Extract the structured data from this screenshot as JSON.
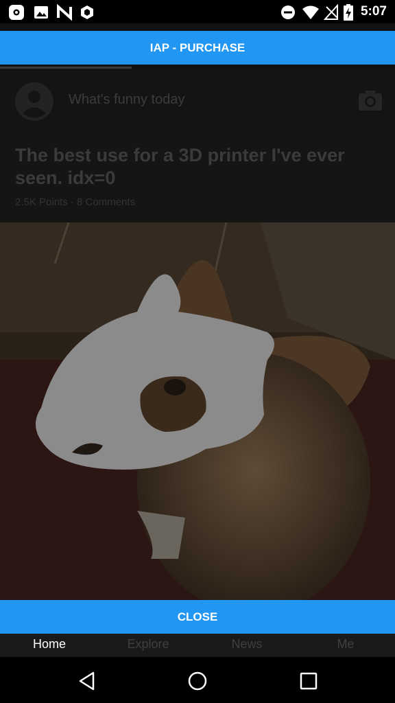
{
  "status_bar": {
    "time": "5:07",
    "left_icons": [
      "settings-app-icon",
      "gallery-icon",
      "n-app-icon",
      "shield-app-icon"
    ],
    "right_icons": [
      "do-not-disturb-icon",
      "wifi-icon",
      "no-signal-icon",
      "battery-charging-icon"
    ]
  },
  "iap": {
    "label": "IAP - PURCHASE"
  },
  "composer": {
    "placeholder": "What's funny today"
  },
  "post": {
    "title": "The best use for a 3D printer I've ever seen. idx=0",
    "meta": "2.5K Points · 8 Comments"
  },
  "close": {
    "label": "CLOSE"
  },
  "tabs": [
    {
      "label": "Home",
      "active": true
    },
    {
      "label": "Explore"
    },
    {
      "label": "News"
    },
    {
      "label": "Me"
    }
  ],
  "colors": {
    "accent": "#2196F3",
    "background": "#121212"
  }
}
